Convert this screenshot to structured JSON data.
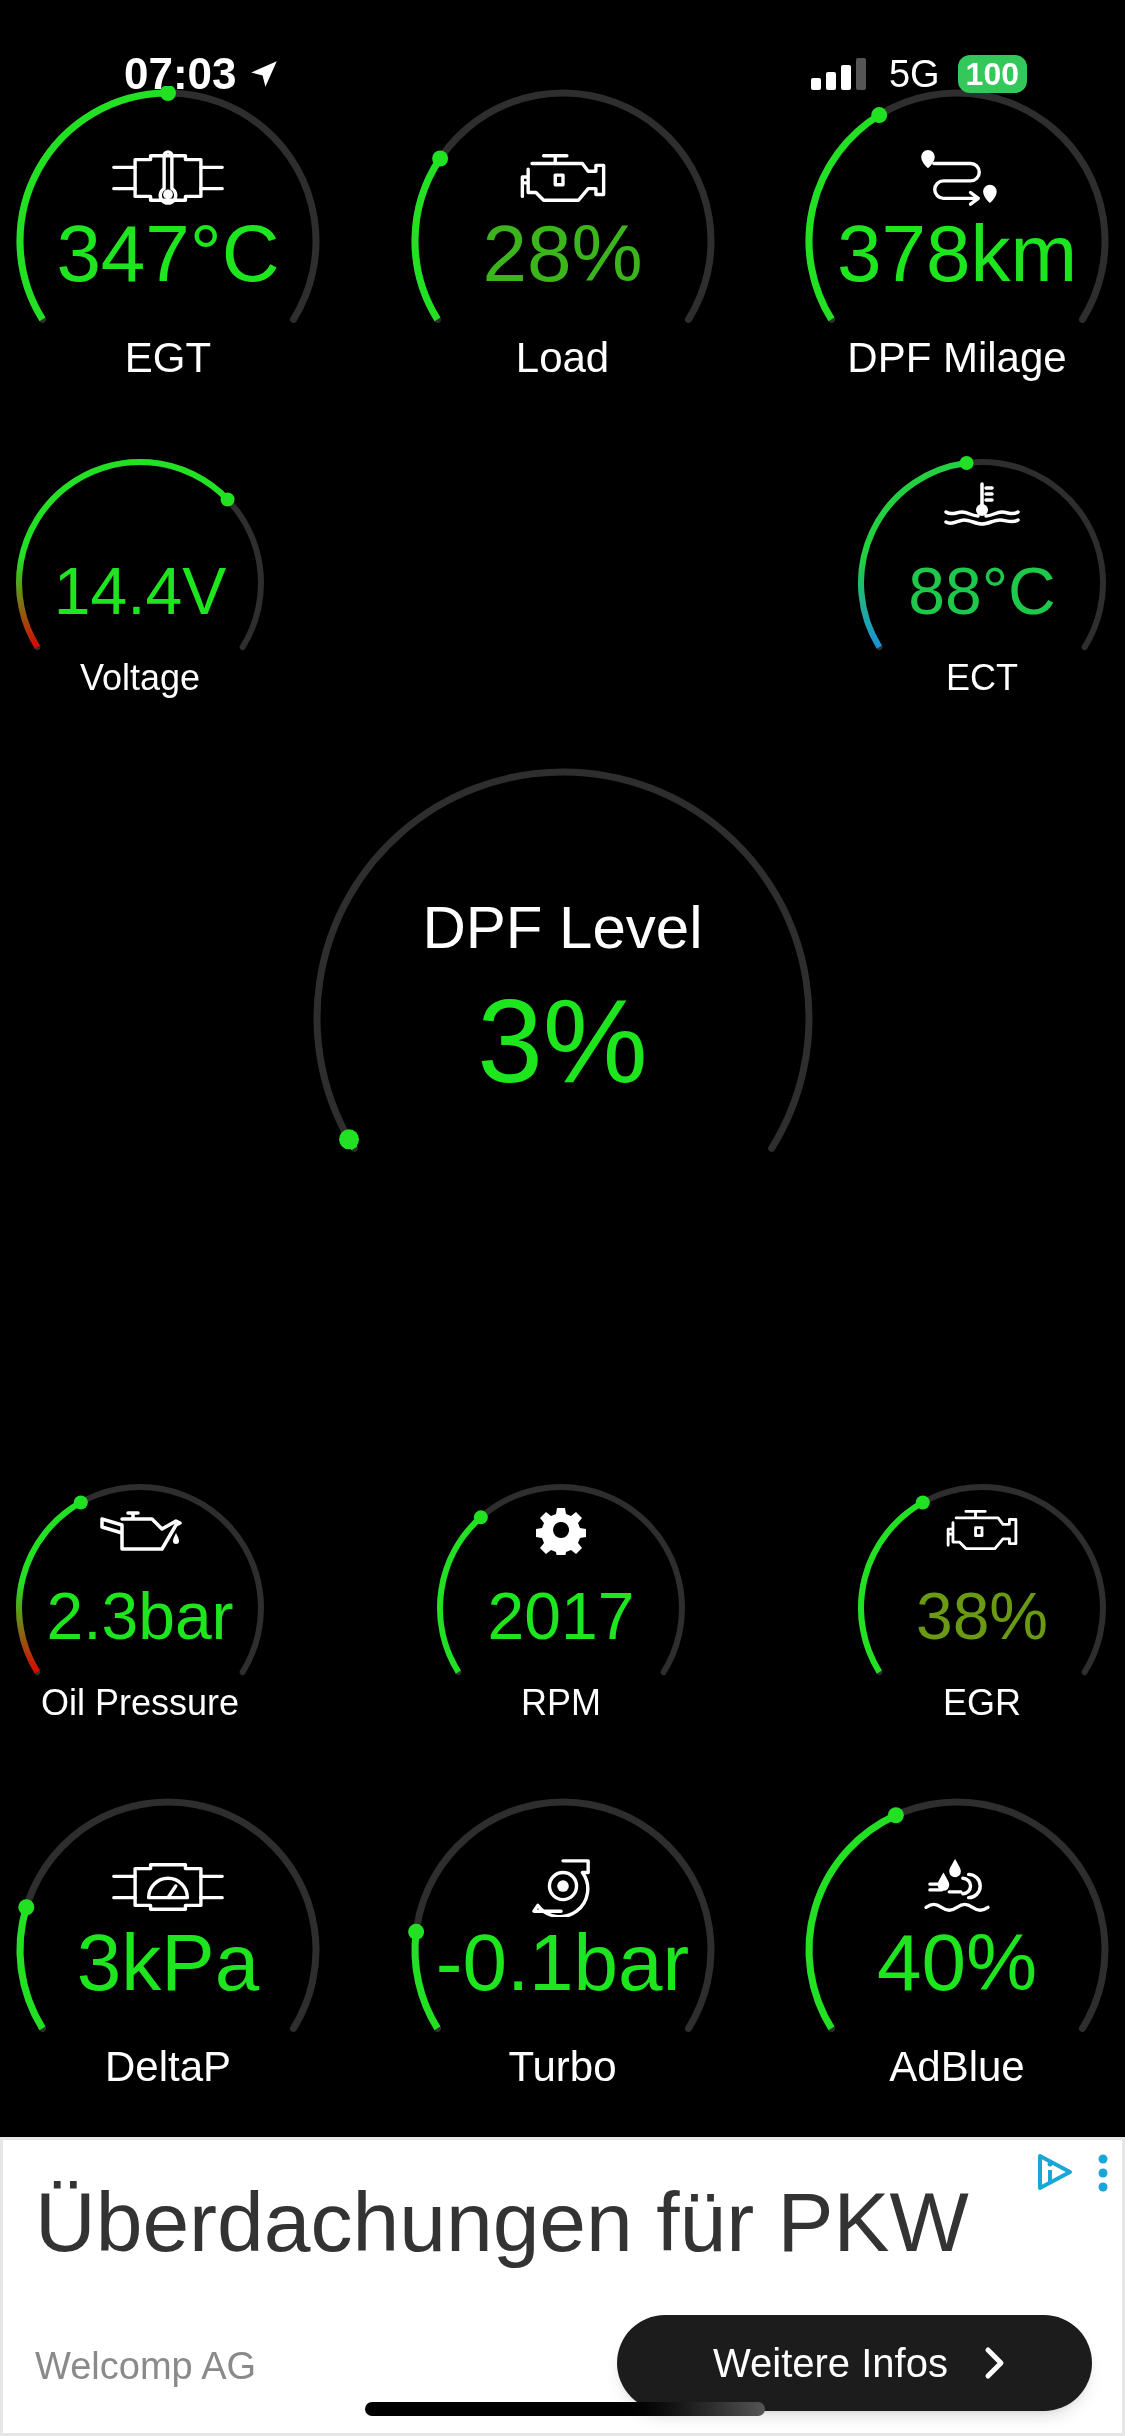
{
  "status_bar": {
    "time": "07:03",
    "network": "5G",
    "battery": "100"
  },
  "top_gauges": [
    {
      "kind": "egt",
      "value": "347°C",
      "label": "EGT",
      "color": "#1ee61e"
    },
    {
      "kind": "load",
      "value": "28%",
      "label": "Load",
      "color": "#3cb41c"
    },
    {
      "kind": "dpf_milage",
      "value": "378km",
      "label": "DPF Milage",
      "color": "#1ee61e"
    }
  ],
  "side_gauges": [
    {
      "kind": "voltage",
      "value": "14.4V",
      "label": "Voltage",
      "color": "#1ee61e"
    },
    {
      "kind": "ect",
      "value": "88°C",
      "label": "ECT",
      "color": "#1ec84a"
    }
  ],
  "dpf_gauge": {
    "kind": "dpf_level",
    "title": "DPF Level",
    "value": "3%",
    "color": "#1ee61e"
  },
  "lower_gauges": [
    {
      "kind": "oil_pressure",
      "value": "2.3bar",
      "label": "Oil Pressure",
      "color": "#1ee61e"
    },
    {
      "kind": "rpm",
      "value": "2017",
      "label": "RPM",
      "color": "#1ee61e"
    },
    {
      "kind": "egr",
      "value": "38%",
      "label": "EGR",
      "color": "#6a9a14"
    }
  ],
  "bottom_gauges": [
    {
      "kind": "delta_p",
      "value": "3kPa",
      "label": "DeltaP",
      "color": "#1ee61e"
    },
    {
      "kind": "turbo",
      "value": "-0.1bar",
      "label": "Turbo",
      "color": "#1ee61e"
    },
    {
      "kind": "adblue",
      "value": "40%",
      "label": "AdBlue",
      "color": "#1ee61e"
    }
  ],
  "ad": {
    "headline": "Überdachungen für PKW",
    "advertiser": "Welcomp AG",
    "button": "Weitere Infos"
  }
}
